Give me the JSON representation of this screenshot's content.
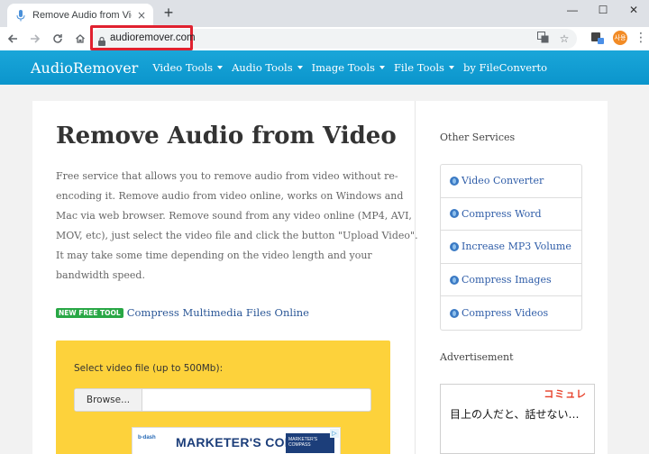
{
  "browser": {
    "tab_title": "Remove Audio from Video Onli",
    "tab_close": "×",
    "new_tab": "+",
    "window_minimize": "—",
    "window_maximize": "☐",
    "window_close": "✕",
    "url": "audioremover.com",
    "profile_initials": "사용"
  },
  "site": {
    "brand": "AudioRemover",
    "nav": [
      {
        "label": "Video Tools",
        "has_dropdown": true
      },
      {
        "label": "Audio Tools",
        "has_dropdown": true
      },
      {
        "label": "Image Tools",
        "has_dropdown": true
      },
      {
        "label": "File Tools",
        "has_dropdown": true
      },
      {
        "label": "by FileConverto",
        "has_dropdown": false
      }
    ]
  },
  "main": {
    "title": "Remove Audio from Video",
    "description_lines": [
      "Free service that allows you to remove audio from video without re-",
      "encoding it. Remove audio from video online, works on Windows and",
      "Mac via web browser. Remove sound from any video online (MP4, AVI,",
      "MOV, etc), just select the video file and click the button \"Upload Video\".",
      "It may take some time depending on the video length and your",
      "bandwidth speed."
    ],
    "promo_badge": "NEW FREE TOOL",
    "promo_link": "Compress Multimedia Files Online",
    "upload_label": "Select video file (up to 500Mb):",
    "browse_label": "Browse...",
    "ad": {
      "logo": "b-dash",
      "title": "MARKETER'S COMPASS",
      "book": "MARKETER'S COMPASS"
    }
  },
  "sidebar": {
    "other_services_title": "Other Services",
    "services": [
      "Video Converter",
      "Compress Word",
      "Increase MP3 Volume",
      "Compress Images",
      "Compress Videos"
    ],
    "advertisement_title": "Advertisement",
    "ad_brand": "コミュレ",
    "ad_text": "目上の人だと、話せない…"
  },
  "colors": {
    "nav_bar": "#0b95cc",
    "upload_box": "#fdd23b",
    "link": "#2f5da8",
    "badge": "#28a745",
    "url_highlight": "#e0212f"
  }
}
